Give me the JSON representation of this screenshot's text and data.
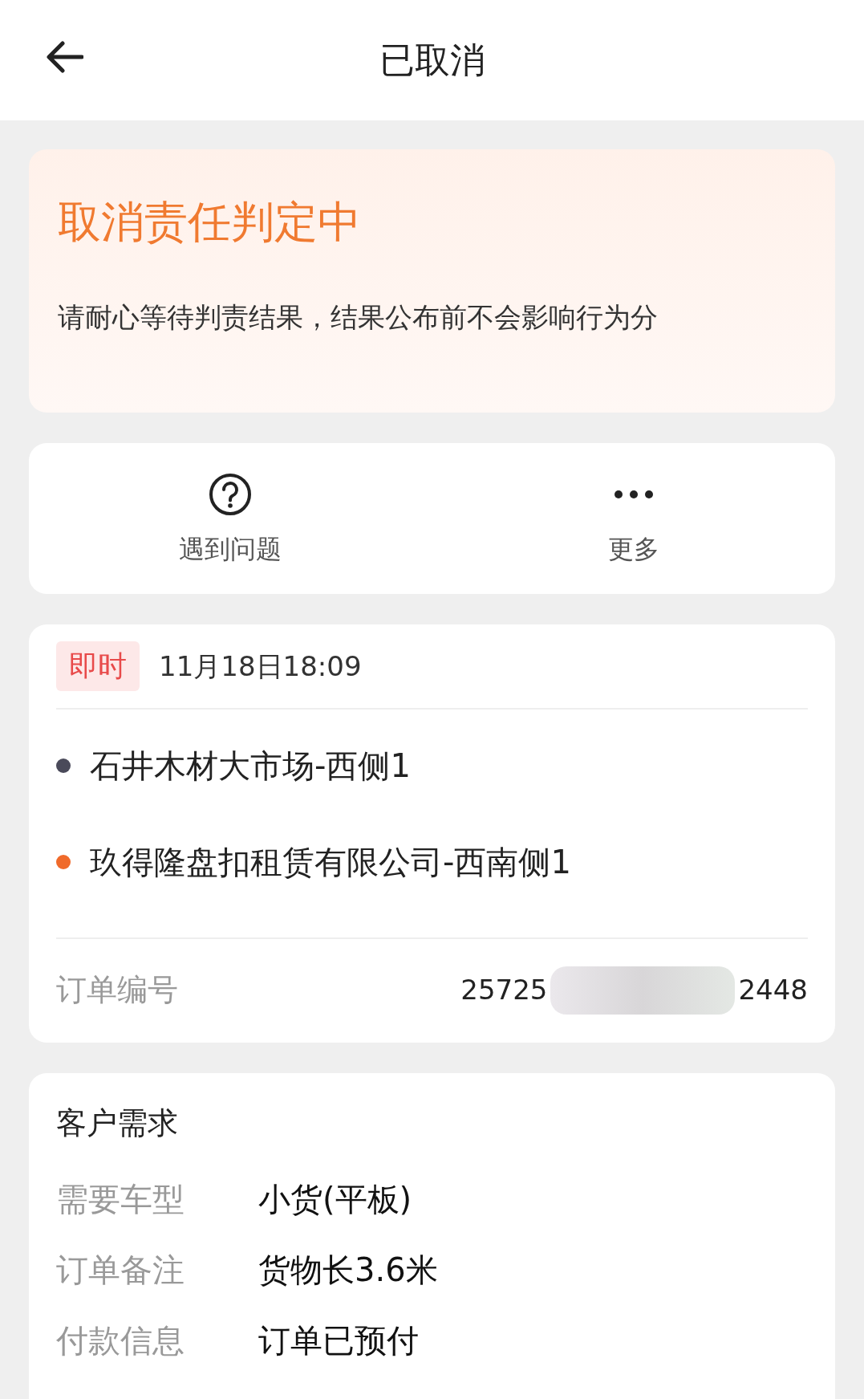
{
  "header": {
    "title": "已取消"
  },
  "status_card": {
    "heading": "取消责任判定中",
    "message": "请耐心等待判责结果，结果公布前不会影响行为分"
  },
  "actions": [
    {
      "kind": "help",
      "label": "遇到问题"
    },
    {
      "kind": "more",
      "label": "更多"
    }
  ],
  "order": {
    "tag": "即时",
    "time": "11月18日18:09",
    "stops": [
      {
        "name": "石井木材大市场-西侧1",
        "color": "#4a4a5a"
      },
      {
        "name": "玖得隆盘扣租赁有限公司-西南侧1",
        "color": "#f06a2a"
      }
    ],
    "number_label": "订单编号",
    "number_start": "25725",
    "number_end": "2448"
  },
  "requirements": {
    "title": "客户需求",
    "rows": [
      {
        "label": "需要车型",
        "value": "小货(平板)"
      },
      {
        "label": "订单备注",
        "value": "货物长3.6米"
      },
      {
        "label": "付款信息",
        "value": "订单已预付"
      }
    ]
  }
}
